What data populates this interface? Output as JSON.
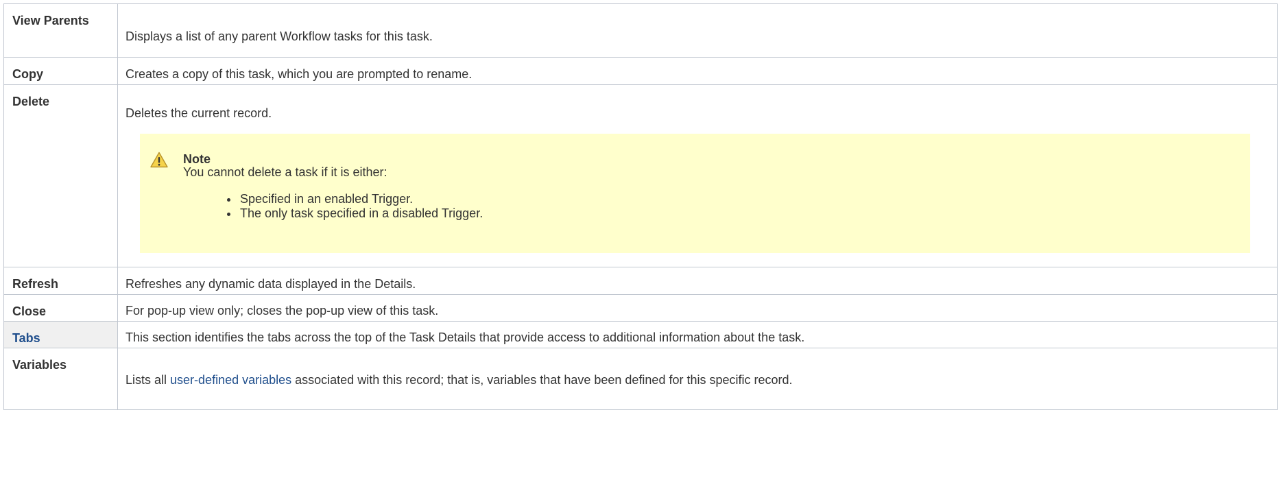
{
  "rows": {
    "view_parents": {
      "label": "View Parents",
      "description": "Displays a list of any parent Workflow tasks for this task."
    },
    "copy": {
      "label": "Copy",
      "description": "Creates a copy of this task, which you are prompted to rename."
    },
    "delete": {
      "label": "Delete",
      "description": "Deletes the current record.",
      "note": {
        "icon": "warning-icon",
        "title": "Note",
        "body": "You cannot delete a task if it is either:",
        "items": [
          "Specified in an enabled Trigger.",
          "The only task specified in a disabled Trigger."
        ]
      }
    },
    "refresh": {
      "label": "Refresh",
      "description": "Refreshes any dynamic data displayed in the Details."
    },
    "close": {
      "label": "Close",
      "description": "For pop-up view only; closes the pop-up view of this task."
    },
    "tabs": {
      "label": "Tabs",
      "description": "This section identifies the tabs across the top of the Task Details that provide access to additional information about the task."
    },
    "variables": {
      "label": "Variables",
      "description_before": "Lists all ",
      "description_link": "user-defined variables",
      "description_after": " associated with this record; that is, variables that have been defined for this specific record."
    }
  },
  "colors": {
    "border": "#c1c7d0",
    "note_background": "#ffffcc",
    "link": "#1f4e8c",
    "section_header_background": "#f0f0f0"
  }
}
